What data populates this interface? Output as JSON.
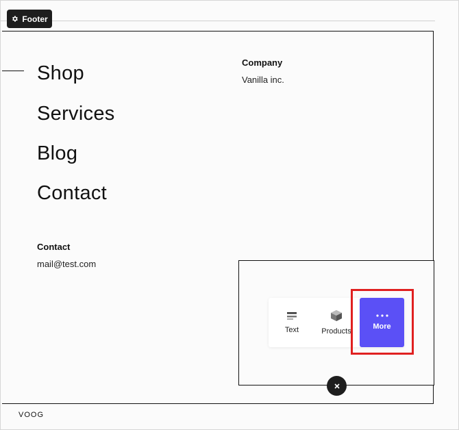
{
  "footer_tag": {
    "label": "Footer",
    "icon": "gear-icon"
  },
  "nav": {
    "items": [
      {
        "label": "Shop"
      },
      {
        "label": "Services"
      },
      {
        "label": "Blog"
      },
      {
        "label": "Contact"
      }
    ]
  },
  "company": {
    "heading": "Company",
    "value": "Vanilla inc."
  },
  "contact": {
    "heading": "Contact",
    "value": "mail@test.com"
  },
  "picker": {
    "items": [
      {
        "label": "Text",
        "icon": "text-icon"
      },
      {
        "label": "Products",
        "icon": "product-box-icon"
      },
      {
        "label": "More",
        "icon": "more-dots-icon"
      }
    ],
    "close_icon": "close-icon"
  },
  "colors": {
    "accent": "#5b50f6",
    "highlight": "#e02020",
    "dark": "#1e1e1e"
  },
  "brand": {
    "logo_text": "VOOG"
  }
}
